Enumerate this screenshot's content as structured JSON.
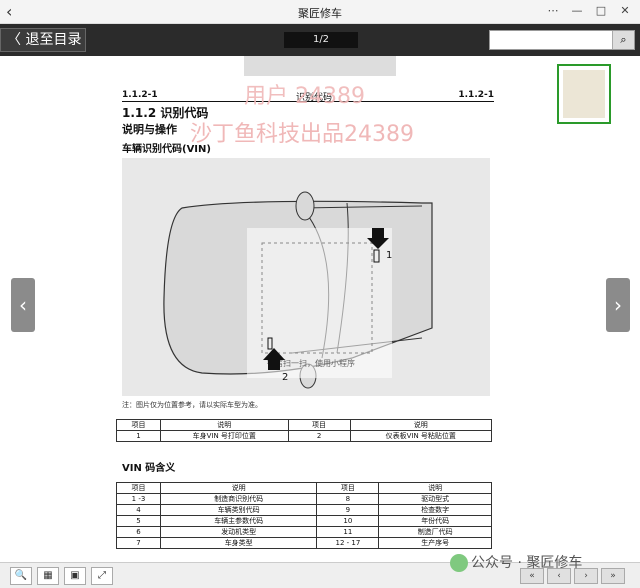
{
  "window": {
    "title": "聚匠修车",
    "back_glyph": "‹",
    "actions": [
      "⋯",
      "—",
      "□",
      "✕"
    ]
  },
  "toolbar": {
    "exit_label": "〈 退至目录",
    "page_indicator": "1/2",
    "search_placeholder": "",
    "search_icon": "search-icon"
  },
  "page": {
    "header_left": "1.1.2-1",
    "header_center": "识别代码",
    "header_right": "1.1.2-1",
    "section_title": "1.1.2  识别代码",
    "subtitle": "说明与操作",
    "vin_heading": "车辆识别代码(VIN)",
    "watermark_1": "用户  24389",
    "watermark_2": "沙丁鱼科技出品24389",
    "diagram_labels": [
      "1",
      "2"
    ],
    "diagram_overlay": "微信扫一扫，使用小程序",
    "note": "注：图片仅为位置参考，请以实际车型为准。",
    "table1": {
      "headers": [
        "项目",
        "说明",
        "项目",
        "说明"
      ],
      "rows": [
        [
          "1",
          "车身VIN 号打印位置",
          "2",
          "仪表板VIN 号粘贴位置"
        ]
      ]
    },
    "vin_meaning_title": "VIN  码含义",
    "table2": {
      "headers": [
        "项目",
        "说明",
        "项目",
        "说明"
      ],
      "rows": [
        [
          "1 -3",
          "制造商识别代码",
          "8",
          "驱动型式"
        ],
        [
          "4",
          "车辆类别代码",
          "9",
          "检查数字"
        ],
        [
          "5",
          "车辆主参数代码",
          "10",
          "年份代码"
        ],
        [
          "6",
          "发动机类型",
          "11",
          "制造厂代码"
        ],
        [
          "7",
          "车身类型",
          "12 - 17",
          "生产序号"
        ]
      ]
    }
  },
  "side": {
    "left_arrow": "‹",
    "right_arrow": "›"
  },
  "bottom": {
    "tools": [
      "🔍",
      "▦",
      "▣",
      "⤢"
    ],
    "nav": [
      "«",
      "‹",
      "›",
      "»"
    ],
    "wechat_label": "公众号 · 聚匠修车"
  }
}
